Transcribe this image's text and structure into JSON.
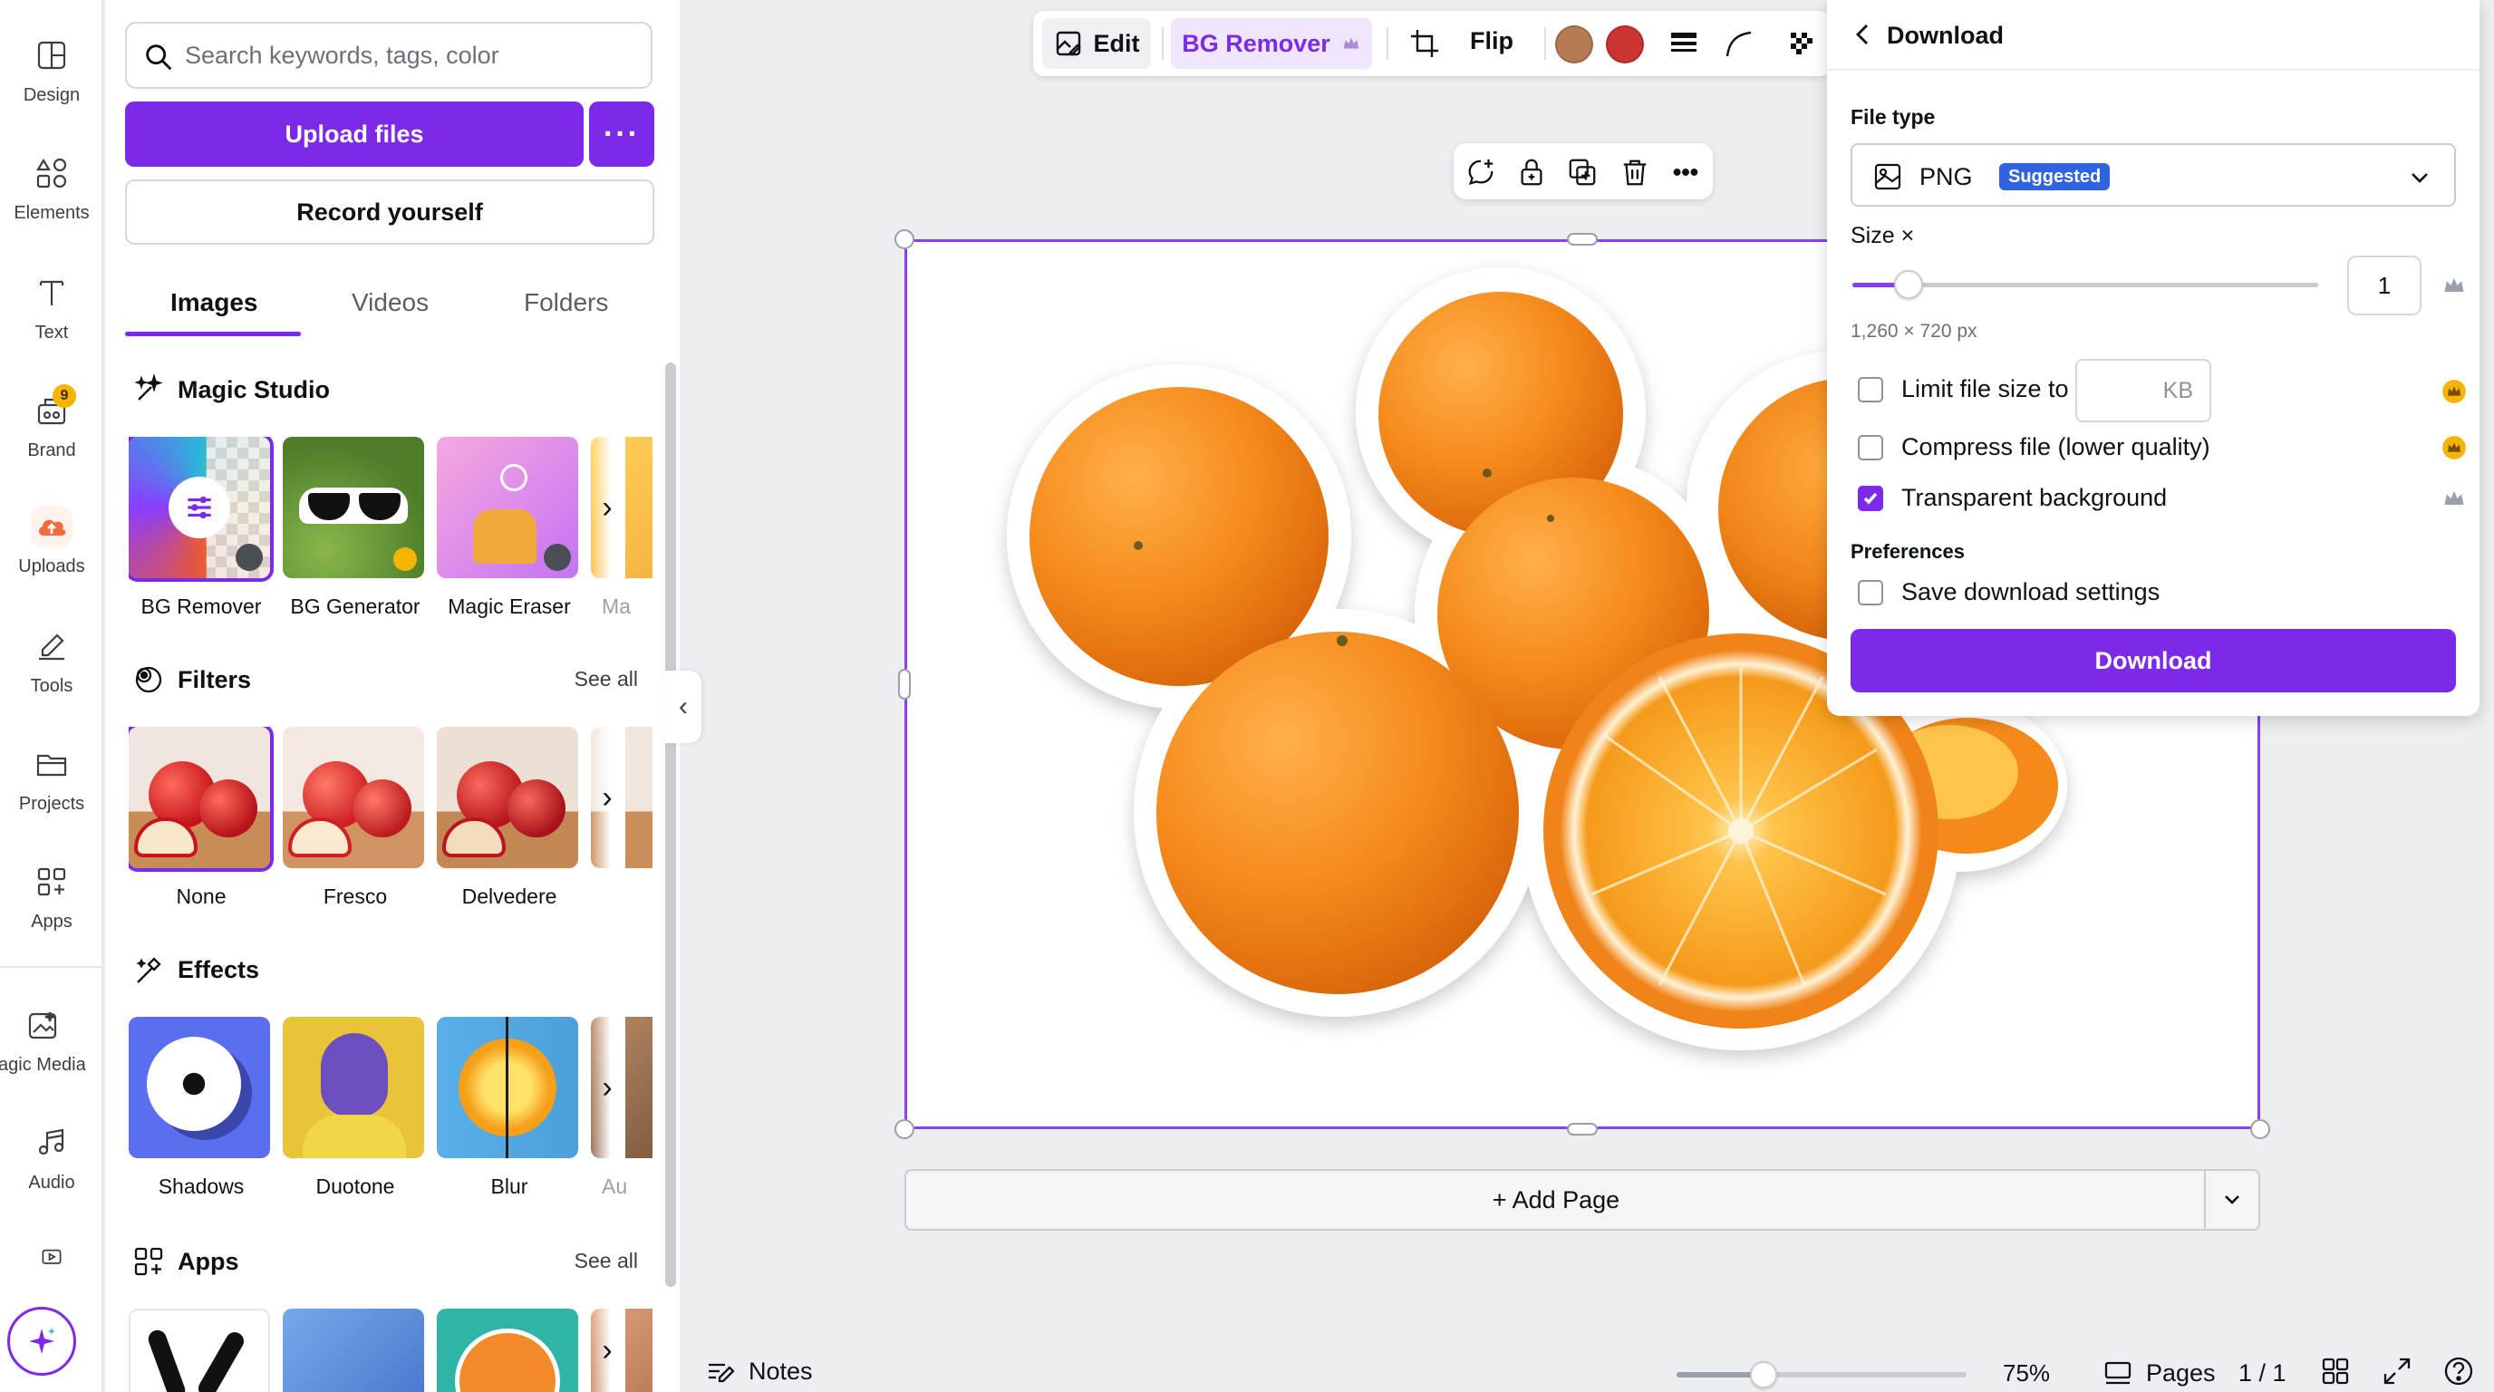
{
  "rail": {
    "items": [
      {
        "label": "Design",
        "icon": "layout-icon"
      },
      {
        "label": "Elements",
        "icon": "shapes-icon"
      },
      {
        "label": "Text",
        "icon": "text-icon"
      },
      {
        "label": "Brand",
        "icon": "brand-icon",
        "badge": "9"
      },
      {
        "label": "Uploads",
        "icon": "cloud-upload-icon"
      },
      {
        "label": "Tools",
        "icon": "pen-icon"
      },
      {
        "label": "Projects",
        "icon": "folder-icon"
      },
      {
        "label": "Apps",
        "icon": "apps-icon"
      },
      {
        "label": "agic Media",
        "icon": "magic-media-icon"
      },
      {
        "label": "Audio",
        "icon": "music-icon"
      }
    ]
  },
  "panel": {
    "search_placeholder": "Search keywords, tags, color",
    "upload_label": "Upload files",
    "more_label": "···",
    "record_label": "Record yourself",
    "tabs": [
      {
        "label": "Images"
      },
      {
        "label": "Videos"
      },
      {
        "label": "Folders"
      }
    ],
    "magic_studio": {
      "title": "Magic Studio",
      "items": [
        {
          "label": "BG Remover"
        },
        {
          "label": "BG Generator"
        },
        {
          "label": "Magic Eraser"
        },
        {
          "label": "Ma"
        }
      ]
    },
    "filters": {
      "title": "Filters",
      "see_all": "See all",
      "items": [
        {
          "label": "None"
        },
        {
          "label": "Fresco"
        },
        {
          "label": "Delvedere"
        }
      ]
    },
    "effects": {
      "title": "Effects",
      "items": [
        {
          "label": "Shadows"
        },
        {
          "label": "Duotone"
        },
        {
          "label": "Blur"
        },
        {
          "label": "Au"
        }
      ]
    },
    "apps": {
      "title": "Apps",
      "see_all": "See all"
    }
  },
  "toolbar": {
    "edit_label": "Edit",
    "bg_remover_label": "BG Remover",
    "flip_label": "Flip",
    "swatch_colors": [
      "#b57b52",
      "#cc3433"
    ]
  },
  "canvas": {
    "add_page_label": "+ Add Page"
  },
  "bottom": {
    "notes_label": "Notes",
    "zoom_label": "75%",
    "zoom_fraction": 0.3,
    "pages_label": "Pages",
    "page_count": "1 / 1"
  },
  "download": {
    "title": "Download",
    "file_type_label": "File type",
    "file_type_value": "PNG",
    "suggested_badge": "Suggested",
    "size_label": "Size ×",
    "size_value": "1",
    "size_fraction": 0.12,
    "dimensions": "1,260 × 720 px",
    "limit_label": "Limit file size to",
    "kb_placeholder": "KB",
    "compress_label": "Compress file (lower quality)",
    "transparent_label": "Transparent background",
    "transparent_checked": true,
    "preferences_label": "Preferences",
    "save_settings_label": "Save download settings",
    "download_button": "Download"
  },
  "colors": {
    "accent": "#7d2ae8",
    "suggested": "#2f63e0",
    "crown": "#f5b400"
  }
}
